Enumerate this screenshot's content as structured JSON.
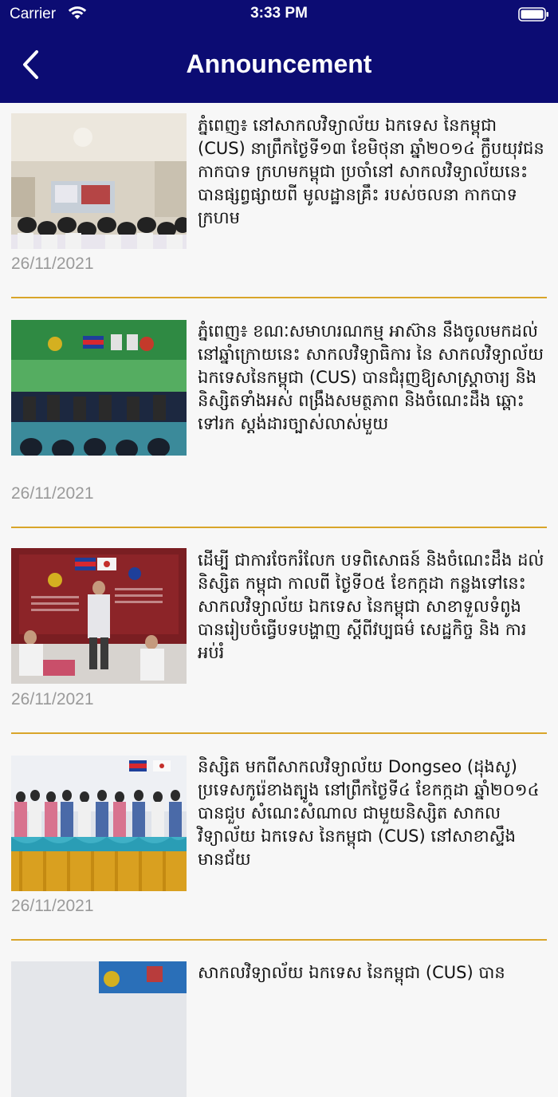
{
  "status_bar": {
    "carrier": "Carrier",
    "time": "3:33 PM"
  },
  "nav": {
    "title": "Announcement",
    "back_icon": "chevron-left-icon"
  },
  "colors": {
    "header_bg": "#0c0c73",
    "divider": "#d9a52a",
    "date_text": "#9a9a9a"
  },
  "announcements": [
    {
      "title": "ភ្នំពេញ៖ នៅសាកលវិទ្យាល័យ ឯកទេស នៃកម្ពុជា (CUS) នាព្រឹកថ្ងៃទី១៣ ខែមិថុនា ឆ្នាំ២០១៤ ក្លឹបយុវជនកាកបាទ ក្រហមកម្ពុជា ប្រចាំនៅ សាកលវិទ្យាល័យនេះ បានផ្សព្វផ្សាយពី មូលដ្ឋានគ្រឹះ របស់ចលនា កាកបាទក្រហម",
      "date": "26/11/2021"
    },
    {
      "title": "ភ្នំពេញ៖ ខណៈសមាហរណកម្ម អាស៊ាន នឹងចូលមកដល់ នៅឆ្នាំក្រោយនេះ សាកលវិទ្យាធិការ នៃ សាកលវិទ្យាល័យ ឯកទេសនៃកម្ពុជា (CUS) បានជំរុញឱ្យសាស្ត្រាចារ្យ និងនិស្សិតទាំងអស់ ពង្រឹងសមត្ថភាព និងចំណេះដឹង ឆ្ពោះទៅរក ស្តង់ដារច្បាស់លាស់មួយ",
      "date": "26/11/2021"
    },
    {
      "title": "ដើម្បី ជាការចែករំលែក បទពិសោធន៍ និងចំណេះដឹង ដល់និស្សិត កម្ពុជា កាលពី ថ្ងៃទី០៥ ខែកក្កដា កន្លងទៅនេះ សាកលវិទ្យាល័យ ឯកទេស នៃកម្ពុជា សាខាទួលទំពូង បានរៀបចំធ្វើបទបង្ហាញ ស្តីពីវប្បធម៌ សេដ្ឋកិច្ច និង ការអប់រំ",
      "date": "26/11/2021"
    },
    {
      "title": "និស្សិត មកពីសាកលវិទ្យាល័យ Dongseo (ដុងសូ) ប្រទេសកូរ៉េខាងត្បូង នៅព្រឹកថ្ងៃទី៤ ខែកក្កដា ឆ្នាំ២០១៤ បានជួប សំណេះសំណាល ជាមួយនិស្សិត សាកលវិទ្យាល័យ ឯកទេស នៃកម្ពុជា (CUS) នៅសាខាស្ទឹងមានជ័យ",
      "date": "26/11/2021"
    },
    {
      "title": "សាកលវិទ្យាល័យ ឯកទេស នៃកម្ពុជា (CUS) បាន",
      "date": ""
    }
  ]
}
